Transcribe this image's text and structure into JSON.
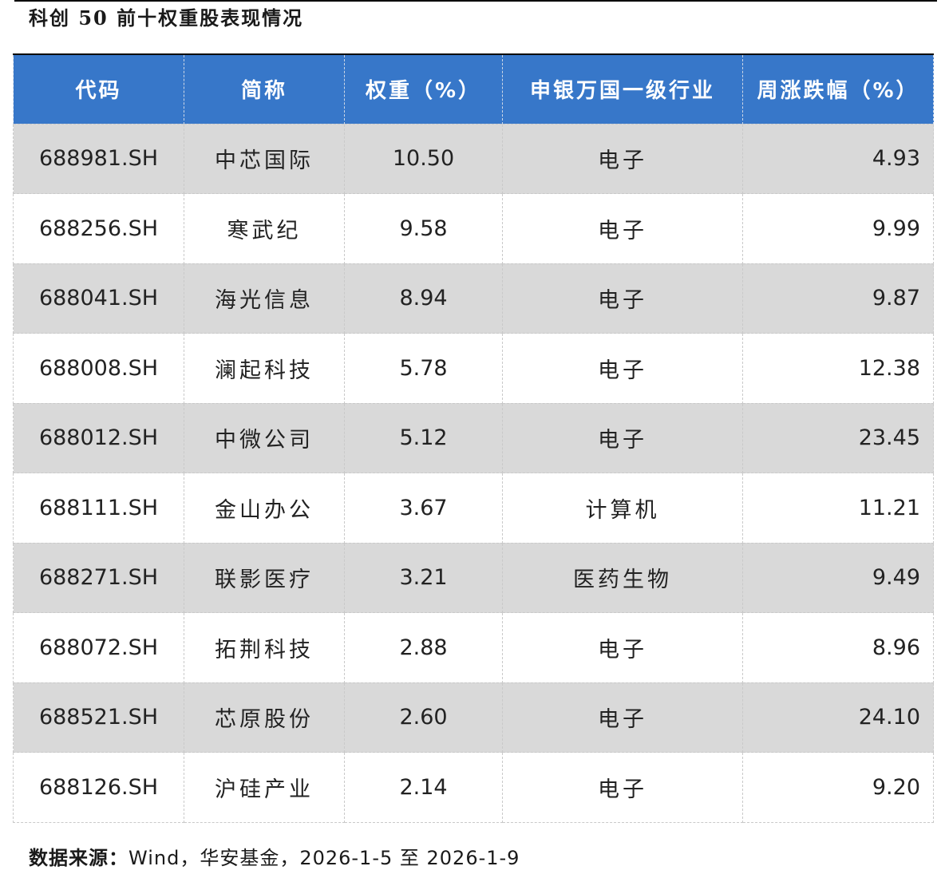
{
  "title": "科创 50 前十权重股表现情况",
  "table": {
    "headers": [
      "代码",
      "简称",
      "权重（%）",
      "申银万国一级行业",
      "周涨跌幅（%）"
    ],
    "rows": [
      {
        "code": "688981.SH",
        "name": "中芯国际",
        "weight": "10.50",
        "industry": "电子",
        "change": "4.93"
      },
      {
        "code": "688256.SH",
        "name": "寒武纪",
        "weight": "9.58",
        "industry": "电子",
        "change": "9.99"
      },
      {
        "code": "688041.SH",
        "name": "海光信息",
        "weight": "8.94",
        "industry": "电子",
        "change": "9.87"
      },
      {
        "code": "688008.SH",
        "name": "澜起科技",
        "weight": "5.78",
        "industry": "电子",
        "change": "12.38"
      },
      {
        "code": "688012.SH",
        "name": "中微公司",
        "weight": "5.12",
        "industry": "电子",
        "change": "23.45"
      },
      {
        "code": "688111.SH",
        "name": "金山办公",
        "weight": "3.67",
        "industry": "计算机",
        "change": "11.21"
      },
      {
        "code": "688271.SH",
        "name": "联影医疗",
        "weight": "3.21",
        "industry": "医药生物",
        "change": "9.49"
      },
      {
        "code": "688072.SH",
        "name": "拓荆科技",
        "weight": "2.88",
        "industry": "电子",
        "change": "8.96"
      },
      {
        "code": "688521.SH",
        "name": "芯原股份",
        "weight": "2.60",
        "industry": "电子",
        "change": "24.10"
      },
      {
        "code": "688126.SH",
        "name": "沪硅产业",
        "weight": "2.14",
        "industry": "电子",
        "change": "9.20"
      }
    ]
  },
  "source": {
    "label": "数据来源：",
    "text": "Wind，华安基金，2026-1-5 至 2026-1-9"
  },
  "colors": {
    "header_bg": "#3777c9",
    "header_text": "#ffffff",
    "row_shade": "#d9d9d9"
  }
}
